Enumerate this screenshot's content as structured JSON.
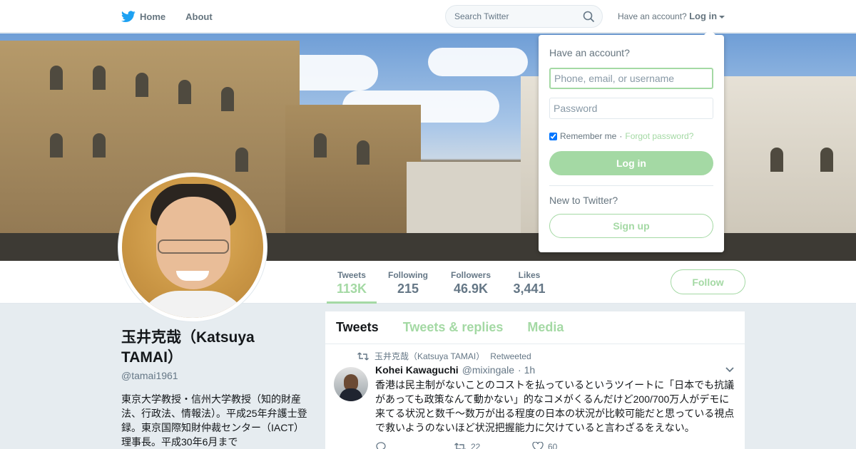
{
  "nav": {
    "home_label": "Home",
    "about_label": "About",
    "search_placeholder": "Search Twitter",
    "account_prompt": "Have an account?",
    "login_label": "Log in"
  },
  "profile": {
    "name": "玉井克哉（Katsuya TAMAI）",
    "handle": "@tamai1961",
    "bio": "東京大学教授・信州大学教授（知的財産法、行政法、情報法）。平成25年弁護士登録。東京国際知財仲裁センター（IACT）理事長。平成30年6月まで"
  },
  "stats": [
    {
      "label": "Tweets",
      "value": "113K"
    },
    {
      "label": "Following",
      "value": "215"
    },
    {
      "label": "Followers",
      "value": "46.9K"
    },
    {
      "label": "Likes",
      "value": "3,441"
    }
  ],
  "follow_label": "Follow",
  "tabs": [
    "Tweets",
    "Tweets & replies",
    "Media"
  ],
  "tweet": {
    "retweeted_by": "玉井克哉（Katsuya TAMAI）",
    "retweeted_label": "Retweeted",
    "author_name": "Kohei Kawaguchi",
    "author_handle": "@mixingale",
    "time": "· 1h",
    "text": "香港は民主制がないことのコストを払っているというツイートに「日本でも抗議があっても政策なんて動かない」的なコメがくるんだけど200/700万人がデモに来てる状況と数千〜数万が出る程度の日本の状況が比較可能だと思っている視点で救いようのないほど状況把握能力に欠けていると言わざるをえない。",
    "reply_count": "",
    "retweet_count": "22",
    "like_count": "60"
  },
  "login_dropdown": {
    "title": "Have an account?",
    "username_placeholder": "Phone, email, or username",
    "password_placeholder": "Password",
    "remember_label": "Remember me",
    "separator": "·",
    "forgot_label": "Forgot password?",
    "login_button": "Log in",
    "new_prompt": "New to Twitter?",
    "signup_button": "Sign up"
  },
  "colors": {
    "accent": "#a4d9a4",
    "twitter_blue": "#1da1f2",
    "muted": "#657786"
  }
}
